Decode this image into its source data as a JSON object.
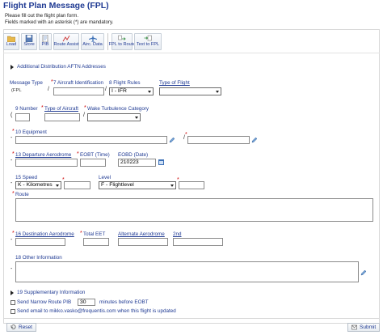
{
  "header": {
    "title": "Flight Plan Message (FPL)",
    "intro_line1": "Please fill out the flight plan form.",
    "intro_line2": "Fields marked with an asterisk (*) are mandatory."
  },
  "toolbar": {
    "load": "Load",
    "store": "Store",
    "pib": "PIB",
    "route_assist": "Route Assist",
    "airc_data": "Airc. Data",
    "fpl_to_route": "FPL to Route",
    "text_to_fpl": "Text to FPL"
  },
  "additional_addresses": "Additional Distribution AFTN Addresses",
  "message_type": {
    "label": "Message Type",
    "value": "(FPL"
  },
  "aircraft_id": {
    "label": "7 Aircraft Identification",
    "value": ""
  },
  "flight_rules": {
    "label": "8 Flight Rules",
    "value": "I - IFR"
  },
  "type_of_flight": {
    "label": "Type of Flight",
    "value": ""
  },
  "number": {
    "label": "9 Number",
    "value": ""
  },
  "type_of_aircraft": {
    "label": "Type of Aircraft",
    "value": ""
  },
  "wake_turbulence": {
    "label": "Wake Turbulence Category",
    "value": ""
  },
  "equipment": {
    "label": "10 Equipment",
    "value1": "",
    "value2": ""
  },
  "departure": {
    "label": "13 Departure Aerodrome",
    "value": ""
  },
  "eobt": {
    "label": "EOBT (Time)",
    "value": ""
  },
  "eobd": {
    "label": "EOBD (Date)",
    "value": "210223"
  },
  "speed": {
    "label": "15 Speed",
    "unit": "K - Kilometres",
    "value": ""
  },
  "level": {
    "label": "Level",
    "unit": "F - Flightlevel",
    "value": ""
  },
  "route": {
    "label": "Route",
    "value": ""
  },
  "destination": {
    "label": "16 Destination Aerodrome",
    "value": ""
  },
  "total_eet": {
    "label": "Total EET",
    "value": ""
  },
  "alternate": {
    "label": "Alternate Aerodrome",
    "value": ""
  },
  "second": {
    "label": "2nd",
    "value": ""
  },
  "other_info": {
    "label": "18 Other Information",
    "value": ""
  },
  "supplementary": "19 Supplementary Information",
  "narrow_route": {
    "before": "Send Narrow Route PIB",
    "value": "30",
    "after": "minutes before EOBT"
  },
  "send_email": "Send email to mikko.vasko@frequentis.com when this flight is updated",
  "footer": {
    "reset": "Reset",
    "submit": "Submit"
  },
  "colors": {
    "accent": "#1f3a93",
    "required": "#cc0000"
  }
}
